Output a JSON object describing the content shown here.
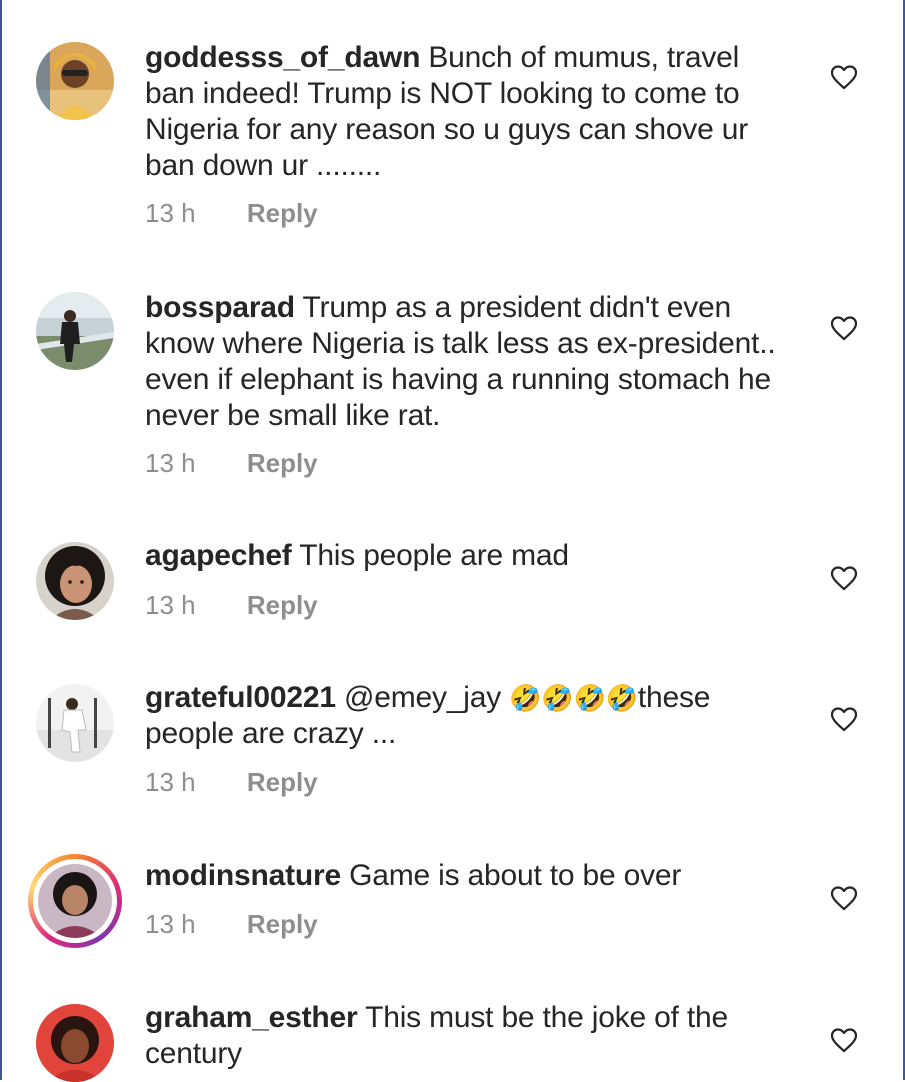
{
  "comments": [
    {
      "username": "goddesss_of_dawn",
      "text": "Bunch of mumus, travel ban indeed! Trump is NOT looking to come to Nigeria for any reason so u guys can shove ur ban down ur ........",
      "time": "13 h",
      "reply_label": "Reply",
      "like_icon": "heart-outline-icon"
    },
    {
      "username": "bossparad",
      "text": "Trump as a president didn't even know where Nigeria is talk less as ex-president.. even if elephant is having a running stomach he never be small like rat.",
      "time": "13 h",
      "reply_label": "Reply",
      "like_icon": "heart-outline-icon"
    },
    {
      "username": "agapechef",
      "text": "This people are mad",
      "time": "13 h",
      "reply_label": "Reply",
      "like_icon": "heart-outline-icon"
    },
    {
      "username": "grateful00221",
      "mention": "@emey_jay",
      "emoji": "🤣🤣🤣🤣",
      "text": "these people are crazy ...",
      "time": "13 h",
      "reply_label": "Reply",
      "like_icon": "heart-outline-icon"
    },
    {
      "username": "modinsnature",
      "text": "Game is about to be over",
      "time": "13 h",
      "reply_label": "Reply",
      "like_icon": "heart-outline-icon",
      "has_story_ring": true
    },
    {
      "username": "graham_esther",
      "text": "This must be the joke of the century",
      "like_icon": "heart-outline-icon"
    }
  ],
  "colors": {
    "text": "#262626",
    "meta": "#8e8e8e",
    "frame": "#3b5998"
  }
}
